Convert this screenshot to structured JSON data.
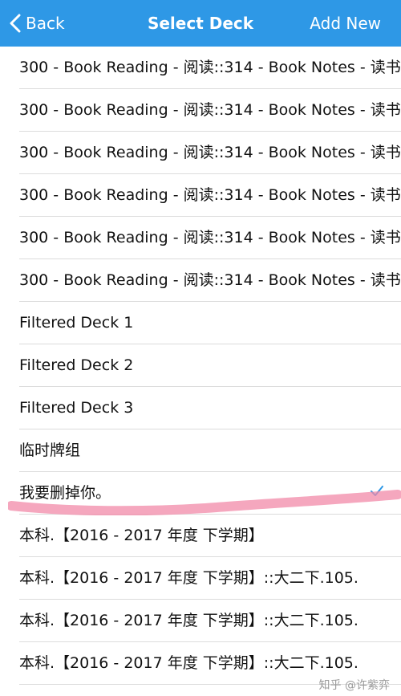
{
  "navbar": {
    "back_label": "Back",
    "title": "Select Deck",
    "add_label": "Add New",
    "background_color": "#2e98e6"
  },
  "decks": [
    {
      "label": "300 - Book Reading - 阅读::314 - Book Notes - 读书"
    },
    {
      "label": "300 - Book Reading - 阅读::314 - Book Notes - 读书"
    },
    {
      "label": "300 - Book Reading - 阅读::314 - Book Notes - 读书"
    },
    {
      "label": "300 - Book Reading - 阅读::314 - Book Notes - 读书"
    },
    {
      "label": "300 - Book Reading - 阅读::314 - Book Notes - 读书"
    },
    {
      "label": "300 - Book Reading - 阅读::314 - Book Notes - 读书"
    },
    {
      "label": "Filtered Deck 1"
    },
    {
      "label": "Filtered Deck 2"
    },
    {
      "label": "Filtered Deck 3"
    },
    {
      "label": "临时牌组"
    },
    {
      "label": "我要删掉你。",
      "selected": true
    },
    {
      "label": "本科.【2016 - 2017 年度 下学期】"
    },
    {
      "label": "本科.【2016 - 2017 年度 下学期】::大二下.105."
    },
    {
      "label": "本科.【2016 - 2017 年度 下学期】::大二下.105."
    },
    {
      "label": "本科.【2016 - 2017 年度 下学期】::大二下.105."
    }
  ],
  "icons": {
    "back": "chevron-left-icon",
    "selected": "checkmark-icon"
  },
  "highlight_color": "#f28aa8",
  "watermark": "知乎 @许紫弈"
}
